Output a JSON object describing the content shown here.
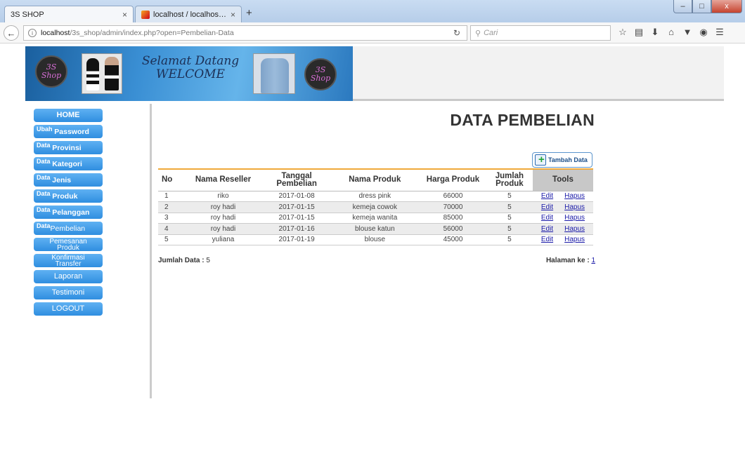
{
  "browser": {
    "tabs": [
      {
        "label": "3S SHOP",
        "close": "×"
      },
      {
        "label": "localhost / localhost / 3s_s...",
        "close": "×"
      }
    ],
    "new_tab": "+",
    "url_host": "localhost",
    "url_path": "/3s_shop/admin/index.php?open=Pembelian-Data",
    "search_placeholder": "Cari",
    "window_buttons": {
      "minimize": "–",
      "maximize": "□",
      "close": "x"
    }
  },
  "banner": {
    "logo_line1": "3S",
    "logo_line2": "Shop",
    "welcome_line1": "Selamat Datang",
    "welcome_line2": "WELCOME"
  },
  "sidebar": {
    "items": [
      {
        "label": "HOME"
      },
      {
        "small": "Ubah",
        "big": "Password"
      },
      {
        "small": "Data",
        "big": "Provinsi"
      },
      {
        "small": "Data",
        "big": "Kategori"
      },
      {
        "small": "Data",
        "big": "Jenis"
      },
      {
        "small": "Data",
        "big": "Produk"
      },
      {
        "small": "Data",
        "big": "Pelanggan"
      },
      {
        "small": "Data",
        "big": "Pembelian"
      },
      {
        "line1": "Pemesanan",
        "line2": "Produk"
      },
      {
        "line1": "Konfirmasi",
        "line2": "Transfer"
      },
      {
        "label": "Laporan"
      },
      {
        "label": "Testimoni"
      },
      {
        "label": "LOGOUT"
      }
    ]
  },
  "main": {
    "title": "DATA PEMBELIAN",
    "add_button": "Tambah Data",
    "table": {
      "headers": [
        "No",
        "Nama Reseller",
        "Tanggal Pembelian",
        "Nama Produk",
        "Harga Produk",
        "Jumlah Produk",
        "Tools"
      ],
      "rows": [
        {
          "no": "1",
          "reseller": "riko",
          "tanggal": "2017-01-08",
          "produk": "dress pink",
          "harga": "66000",
          "jumlah": "5"
        },
        {
          "no": "2",
          "reseller": "roy hadi",
          "tanggal": "2017-01-15",
          "produk": "kemeja cowok",
          "harga": "70000",
          "jumlah": "5"
        },
        {
          "no": "3",
          "reseller": "roy hadi",
          "tanggal": "2017-01-15",
          "produk": "kemeja wanita",
          "harga": "85000",
          "jumlah": "5"
        },
        {
          "no": "4",
          "reseller": "roy hadi",
          "tanggal": "2017-01-16",
          "produk": "blouse katun",
          "harga": "56000",
          "jumlah": "5"
        },
        {
          "no": "5",
          "reseller": "yuliana",
          "tanggal": "2017-01-19",
          "produk": "blouse",
          "harga": "45000",
          "jumlah": "5"
        }
      ],
      "edit_label": "Edit",
      "delete_label": "Hapus"
    },
    "footer": {
      "count_label": "Jumlah Data :",
      "count_value": "5",
      "page_label": "Halaman ke :",
      "page_value": "1"
    }
  }
}
